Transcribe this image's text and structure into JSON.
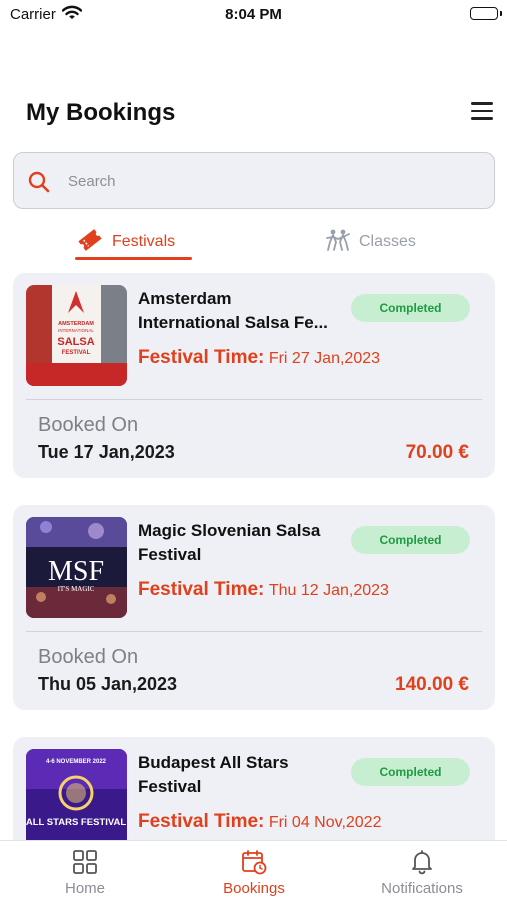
{
  "status_bar": {
    "carrier": "Carrier",
    "time": "8:04 PM"
  },
  "header": {
    "title": "My Bookings"
  },
  "search": {
    "placeholder": "Search",
    "value": ""
  },
  "tabs": [
    {
      "label": "Festivals",
      "icon": "ticket-icon",
      "active": true
    },
    {
      "label": "Classes",
      "icon": "dancers-icon",
      "active": false
    }
  ],
  "bookings": [
    {
      "title_line1": "Amsterdam",
      "title_line2": "International Salsa Fe...",
      "status": "Completed",
      "festival_time_label": "Festival Time:",
      "festival_time": "Fri 27 Jan,2023",
      "booked_on_label": "Booked On",
      "booked_on": "Tue 17 Jan,2023",
      "price": "70.00 €",
      "poster_text": [
        "AMSTERDAM",
        "INTERNATIONAL",
        "SALSA",
        "FESTIVAL"
      ]
    },
    {
      "title_line1": "Magic Slovenian Salsa",
      "title_line2": "Festival",
      "status": "Completed",
      "festival_time_label": "Festival Time:",
      "festival_time": "Thu 12 Jan,2023",
      "booked_on_label": "Booked On",
      "booked_on": "Thu 05 Jan,2023",
      "price": "140.00 €",
      "poster_text": [
        "MSF",
        "IT'S MAGIC"
      ]
    },
    {
      "title_line1": "Budapest All Stars",
      "title_line2": "Festival",
      "status": "Completed",
      "festival_time_label": "Festival Time:",
      "festival_time": "Fri 04 Nov,2022",
      "booked_on_label": "Booked On",
      "booked_on": "",
      "price": "",
      "poster_text": [
        "4-6 NOVEMBER 2022",
        "ALL STARS FESTIVAL"
      ]
    }
  ],
  "bottom_nav": [
    {
      "label": "Home",
      "icon": "grid-icon",
      "active": false
    },
    {
      "label": "Bookings",
      "icon": "calendar-clock-icon",
      "active": true
    },
    {
      "label": "Notifications",
      "icon": "bell-icon",
      "active": false
    }
  ],
  "colors": {
    "accent": "#e0401c",
    "badge_bg": "#c8eed2",
    "badge_text": "#1e9a41",
    "card_bg": "#eef0f5"
  }
}
